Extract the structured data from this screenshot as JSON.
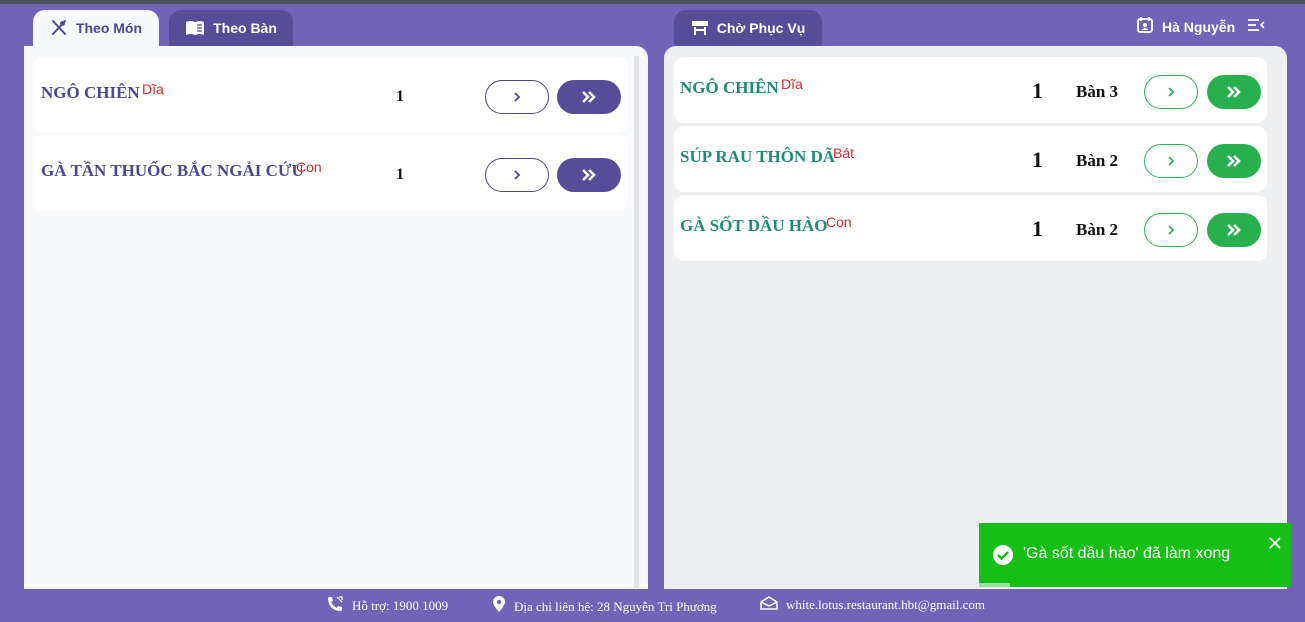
{
  "tabs": {
    "theo_mon": "Theo Món",
    "theo_ban": "Theo Bàn",
    "cho_phuc_vu": "Chờ Phục Vụ"
  },
  "user": {
    "name": "Hà Nguyễn"
  },
  "left_items": [
    {
      "name": "NGÔ CHIÊN",
      "unit": "Dĩa",
      "qty": "1"
    },
    {
      "name": "GÀ TẦN THUỐC BẮC NGẢI CỨU",
      "unit": "Con",
      "qty": "1"
    }
  ],
  "right_items": [
    {
      "name": "NGÔ CHIÊN",
      "unit": "Dĩa",
      "qty": "1",
      "table": "Bàn 3"
    },
    {
      "name": "SÚP RAU THÔN DÃ",
      "unit": "Bát",
      "qty": "1",
      "table": "Bàn 2"
    },
    {
      "name": "GÀ SỐT DẦU HÀO",
      "unit": "Con",
      "qty": "1",
      "table": "Bàn 2"
    }
  ],
  "toast": {
    "message": "'Gà sốt dầu hào' đã làm xong"
  },
  "footer": {
    "support": "Hỗ trợ: 1900 1009",
    "address": "Địa chỉ liên hệ: 28 Nguyễn Tri Phương",
    "email": "white.lotus.restaurant.hbt@gmail.com"
  },
  "colors": {
    "background": "#7163b8",
    "purple_accent": "#574c98",
    "green_accent": "#28b04f",
    "item_name_left": "#4d4690",
    "item_name_right": "#1f8c77",
    "unit_red": "#d22a2a",
    "toast_green": "#15bf16"
  },
  "icons": {
    "theo_mon": "utensils-icon",
    "theo_ban": "book-icon",
    "cho_phuc_vu": "shop-icon",
    "user": "calendar-user-icon",
    "menu": "menu-collapse-icon"
  }
}
